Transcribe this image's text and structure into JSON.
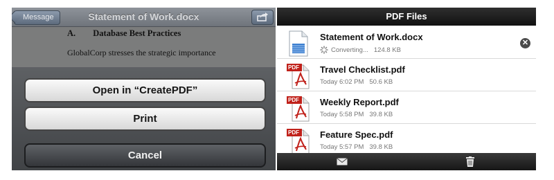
{
  "left": {
    "nav": {
      "back_label": "Message",
      "title": "Statement of Work.docx"
    },
    "document": {
      "heading_number": "A.",
      "heading_text": "Database Best Practices",
      "body_line": "GlobalCorp stresses the strategic importance"
    },
    "action_sheet": {
      "open_in_label": "Open in “CreatePDF”",
      "print_label": "Print",
      "cancel_label": "Cancel"
    }
  },
  "right": {
    "title": "PDF Files",
    "files": [
      {
        "name": "Statement of Work.docx",
        "date": "Converting...",
        "size": "124.8 KB",
        "icon": "document-icon",
        "converting": true
      },
      {
        "name": "Travel Checklist.pdf",
        "date": "Today 6:02 PM",
        "size": "50.6 KB",
        "icon": "pdf-icon"
      },
      {
        "name": "Weekly Report.pdf",
        "date": "Today 5:58 PM",
        "size": "39.8 KB",
        "icon": "pdf-icon"
      },
      {
        "name": "Feature Spec.pdf",
        "date": "Today 5:57 PM",
        "size": "39.8 KB",
        "icon": "pdf-icon"
      }
    ],
    "pdf_badge": "PDF",
    "toolbar": {
      "left_icon": "mail-icon",
      "right_icon": "trash-icon"
    }
  }
}
